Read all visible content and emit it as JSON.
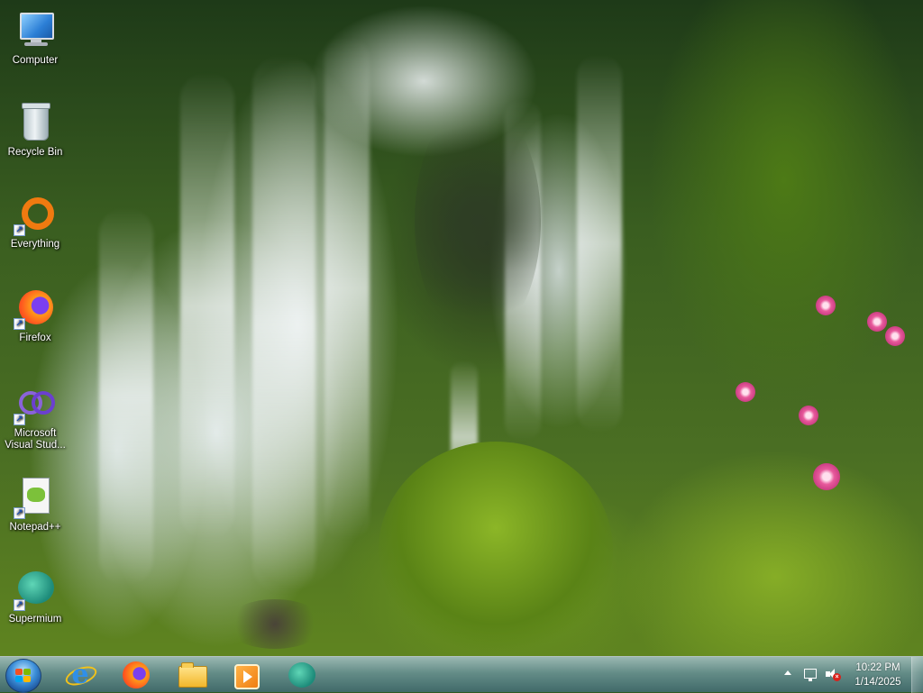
{
  "desktop": {
    "icons": [
      {
        "label": "Computer",
        "icon": "computer-icon",
        "shortcut": false
      },
      {
        "label": "Recycle Bin",
        "icon": "recycle-bin-icon",
        "shortcut": false
      },
      {
        "label": "Everything",
        "icon": "everything-icon",
        "shortcut": true
      },
      {
        "label": "Firefox",
        "icon": "firefox-icon",
        "shortcut": true
      },
      {
        "label": "Microsoft Visual Stud...",
        "icon": "visual-studio-icon",
        "shortcut": true
      },
      {
        "label": "Notepad++",
        "icon": "notepad-plus-plus-icon",
        "shortcut": true
      },
      {
        "label": "Supermium",
        "icon": "supermium-icon",
        "shortcut": true
      }
    ]
  },
  "taskbar": {
    "start_icon": "windows-start-orb",
    "pinned": [
      {
        "icon": "internet-explorer-icon"
      },
      {
        "icon": "firefox-icon"
      },
      {
        "icon": "file-explorer-icon"
      },
      {
        "icon": "media-player-icon"
      },
      {
        "icon": "supermium-icon"
      }
    ],
    "tray": {
      "show_hidden_icon": "chevron-up-icon",
      "network_icon": "network-icon",
      "volume_icon": "volume-muted-icon",
      "clock_time": "10:22 PM",
      "clock_date": "1/14/2025"
    }
  },
  "colors": {
    "icon_label_text": "#ffffff",
    "taskbar_tint": "#6e9aa8",
    "accent_orange": "#f07a10"
  }
}
